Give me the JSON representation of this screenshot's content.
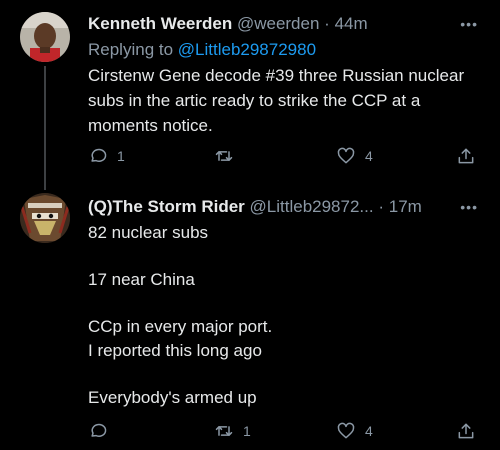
{
  "tweet1": {
    "name": "Kenneth Weerden",
    "handle": "@weerden",
    "time": "44m",
    "replying_prefix": "Replying to ",
    "replying_to": "@Littleb29872980",
    "lines": [
      "Cirstenw Gene decode #39 three Russian nuclear",
      "subs in the artic ready to strike the CCP at a",
      "moments notice."
    ],
    "replies": "1",
    "retweets": "",
    "likes": "4",
    "more": "•••"
  },
  "tweet2": {
    "name": "(Q)The Storm Rider",
    "handle": "@Littleb29872...",
    "time": "17m",
    "lines": [
      "82 nuclear subs",
      "",
      "17 near China",
      "",
      "CCp in every major port.",
      "I reported this long ago",
      "",
      "Everybody's armed up"
    ],
    "replies": "",
    "retweets": "1",
    "likes": "4",
    "more": "•••"
  },
  "icons": {
    "reply": "reply-icon",
    "retweet": "retweet-icon",
    "like": "heart-icon",
    "share": "share-icon"
  }
}
